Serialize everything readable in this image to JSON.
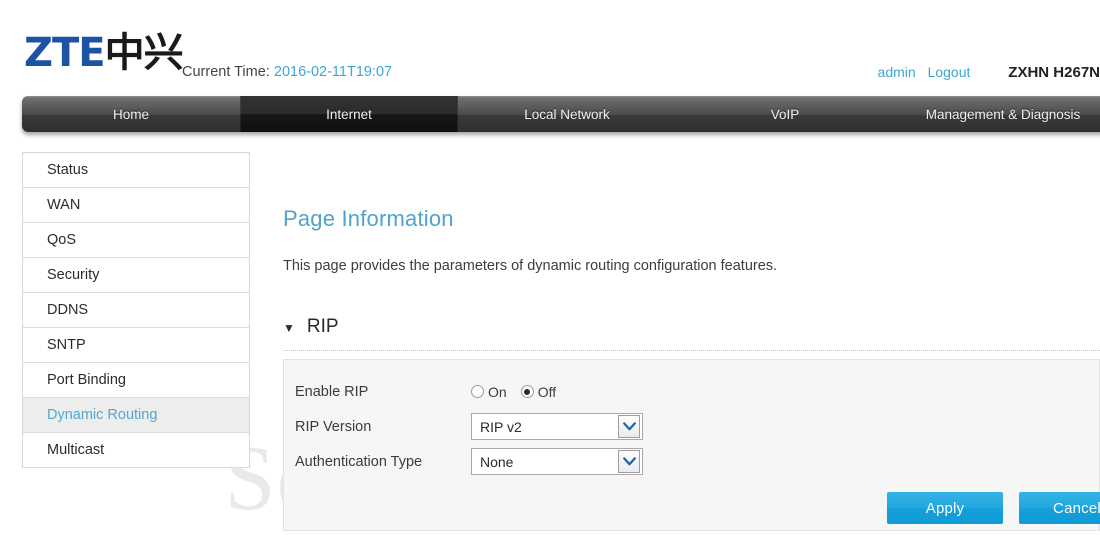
{
  "header": {
    "logo_latin": "ZTE",
    "logo_cjk": "中兴",
    "time_label": "Current Time:",
    "time_value": "2016-02-11T19:07",
    "user": "admin",
    "logout": "Logout",
    "model": "ZXHN H267N",
    "accent_blue": "#3ba7d4",
    "logo_blue": "#1b52a4"
  },
  "nav": {
    "items": [
      {
        "label": "Home",
        "active": false
      },
      {
        "label": "Internet",
        "active": true
      },
      {
        "label": "Local Network",
        "active": false
      },
      {
        "label": "VoIP",
        "active": false
      },
      {
        "label": "Management & Diagnosis",
        "active": false
      }
    ]
  },
  "sidebar": {
    "items": [
      {
        "label": "Status",
        "active": false
      },
      {
        "label": "WAN",
        "active": false
      },
      {
        "label": "QoS",
        "active": false
      },
      {
        "label": "Security",
        "active": false
      },
      {
        "label": "DDNS",
        "active": false
      },
      {
        "label": "SNTP",
        "active": false
      },
      {
        "label": "Port Binding",
        "active": false
      },
      {
        "label": "Dynamic Routing",
        "active": true
      },
      {
        "label": "Multicast",
        "active": false
      }
    ]
  },
  "main": {
    "page_title": "Page Information",
    "page_desc": "This page provides the parameters of dynamic routing configuration features.",
    "section": {
      "caret": "▼",
      "title": "RIP"
    },
    "form": {
      "enable_label": "Enable RIP",
      "enable_on": "On",
      "enable_off": "Off",
      "enable_value": "Off",
      "version_label": "RIP Version",
      "version_value": "RIP v2",
      "auth_label": "Authentication Type",
      "auth_value": "None"
    },
    "buttons": {
      "apply": "Apply",
      "cancel": "Cancel",
      "button_blue": "#21a8df"
    }
  },
  "watermark": {
    "text": "SetupRouter.com"
  }
}
